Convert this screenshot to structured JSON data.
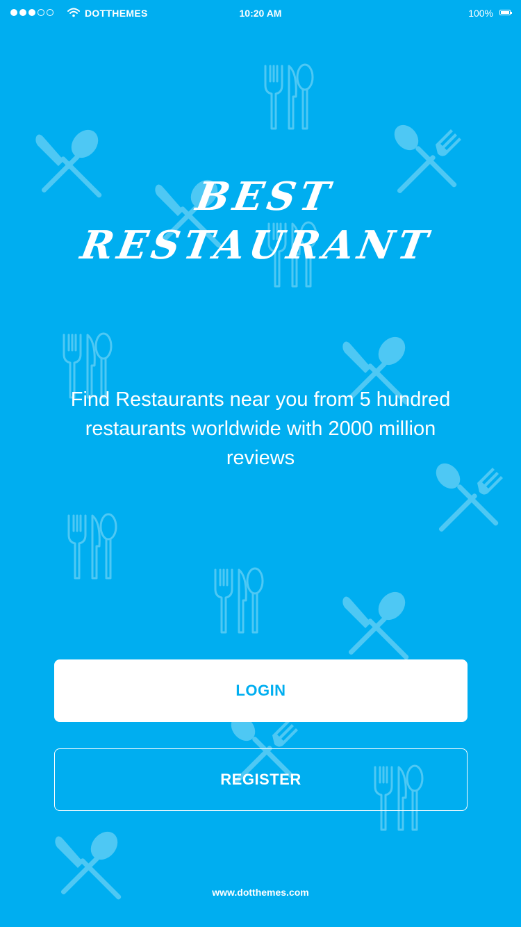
{
  "status_bar": {
    "signal_filled": 3,
    "signal_total": 5,
    "carrier": "DOTTHEMES",
    "time": "10:20 AM",
    "battery": "100%"
  },
  "hero": {
    "title_line1": "BEST",
    "title_line2": "RESTAURANT",
    "tagline": "Find Restaurants near you from 5 hundred restaurants worldwide with 2000 million reviews"
  },
  "actions": {
    "login_label": "LOGIN",
    "register_label": "REGISTER"
  },
  "footer": {
    "link": "www.dotthemes.com"
  },
  "colors": {
    "background": "#00aef0",
    "text": "#ffffff",
    "login_text": "#00aef0",
    "pattern": "#4ec8f4"
  },
  "background_icons": [
    "utensils-icon",
    "knife-spoon-icon",
    "fork-spoon-icon"
  ]
}
